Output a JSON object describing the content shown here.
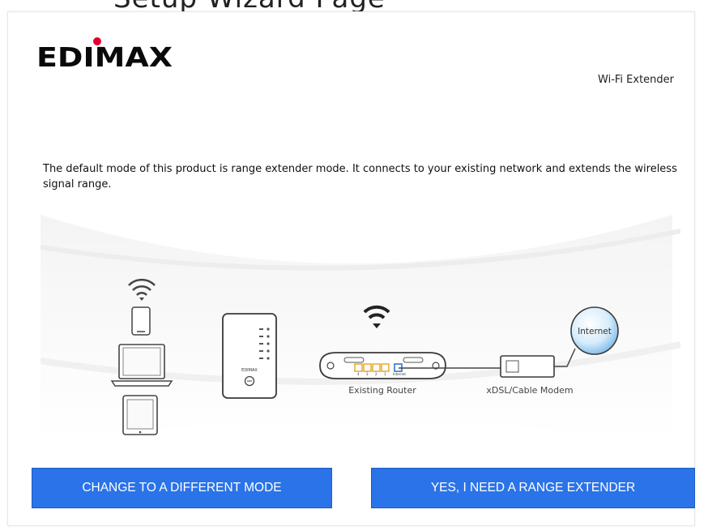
{
  "brand": {
    "name": "EDIMAX",
    "primary_color": "#0a0a0a",
    "dot_color": "#e1002a"
  },
  "header": {
    "product_name": "Wi-Fi Extender",
    "cropped_title": "Setup Wizard Page"
  },
  "main": {
    "description": "The default mode of this product is range extender mode. It connects to your existing network and extends the wireless signal range.",
    "diagram": {
      "extender_brand": "EDIMAX",
      "router_label": "Existing Router",
      "modem_label": "xDSL/Cable Modem",
      "internet_label": "Internet",
      "router_port_labels": [
        "4",
        "3",
        "2",
        "1",
        "Internet"
      ]
    }
  },
  "actions": {
    "change_mode_label": "CHANGE TO A DIFFERENT MODE",
    "range_extender_label": "YES, I NEED A RANGE EXTENDER",
    "button_color": "#2a73e8"
  },
  "icons": [
    "wifi-icon",
    "phone-icon",
    "laptop-icon",
    "tablet-icon",
    "extender-device-icon",
    "router-icon",
    "modem-icon",
    "globe-icon"
  ]
}
